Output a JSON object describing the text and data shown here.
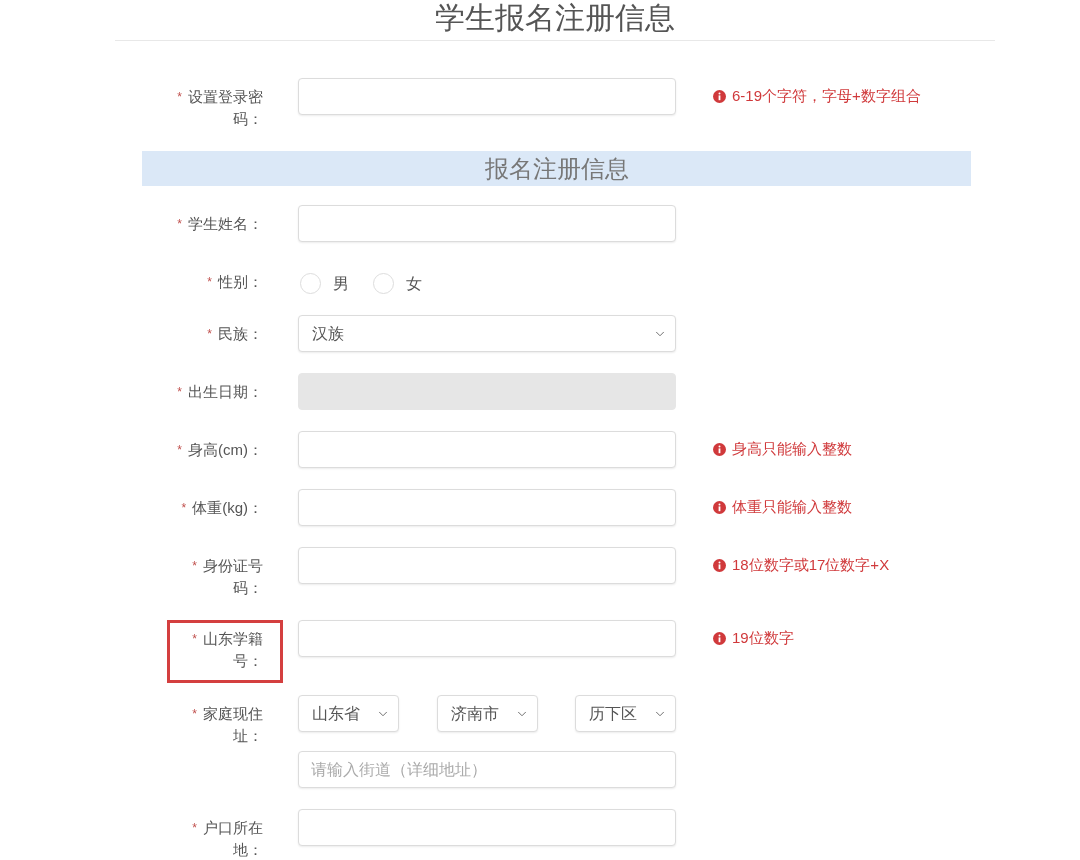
{
  "title": "学生报名注册信息",
  "account_fields": [
    {
      "kind": "text",
      "mark": "*",
      "label": "设置登录密码：",
      "highlighted": false,
      "disabled": false,
      "hint": "6-19个字符，字母+数字组合"
    }
  ],
  "section": {
    "title": "报名注册信息"
  },
  "fields": [
    {
      "kind": "text",
      "mark": "*",
      "label": "学生姓名：",
      "highlighted": false,
      "disabled": false
    },
    {
      "kind": "radio",
      "mark": "*",
      "label": "性别：",
      "highlighted": false,
      "disabled": false,
      "options": [
        {
          "label": "男",
          "selected": false
        },
        {
          "label": "女",
          "selected": false
        }
      ]
    },
    {
      "kind": "select",
      "mark": "*",
      "label": "民族：",
      "highlighted": false,
      "disabled": false,
      "value": "汉族"
    },
    {
      "kind": "text",
      "mark": "*",
      "label": "出生日期：",
      "highlighted": false,
      "disabled": true
    },
    {
      "kind": "text",
      "mark": "*",
      "label": "身高(cm)：",
      "highlighted": false,
      "disabled": false,
      "hint": "身高只能输入整数"
    },
    {
      "kind": "text",
      "mark": "*",
      "label": "体重(kg)：",
      "highlighted": false,
      "disabled": false,
      "hint": "体重只能输入整数"
    },
    {
      "kind": "text",
      "mark": "*",
      "label": "身份证号码：",
      "highlighted": false,
      "disabled": false,
      "hint": "18位数字或17位数字+X"
    },
    {
      "kind": "text",
      "mark": "*",
      "label": "山东学籍号：",
      "highlighted": true,
      "disabled": false,
      "hint": "19位数字"
    },
    {
      "kind": "address",
      "mark": "*",
      "label": "家庭现住址：",
      "highlighted": false,
      "disabled": false,
      "selects": [
        {
          "value": "山东省"
        },
        {
          "value": "济南市"
        },
        {
          "value": "历下区"
        }
      ],
      "street": {
        "placeholder": "请输入街道（详细地址）"
      }
    },
    {
      "kind": "text",
      "mark": "*",
      "label": "户口所在地：",
      "highlighted": false,
      "disabled": false
    }
  ]
}
